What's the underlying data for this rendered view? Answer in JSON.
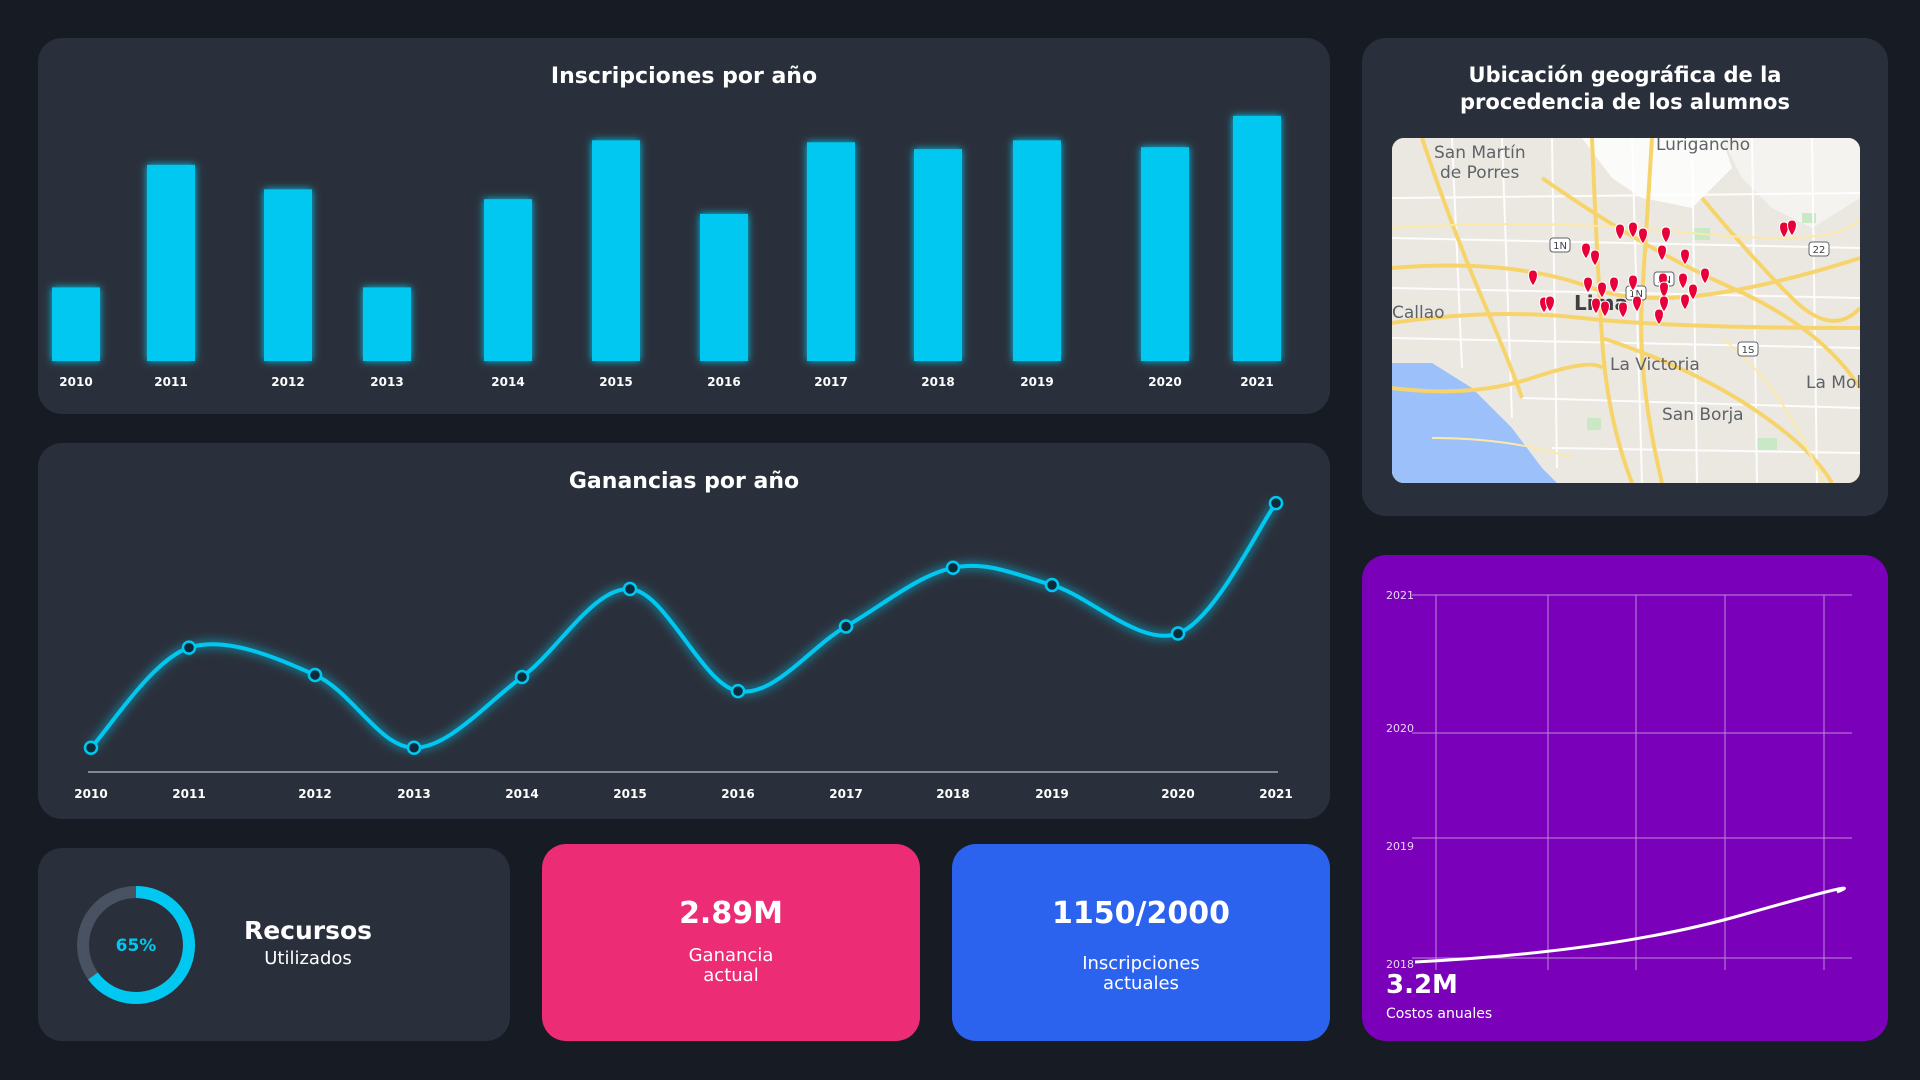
{
  "enrollments": {
    "title": "Inscripciones por año",
    "chart_data": {
      "type": "bar",
      "categories": [
        "2010",
        "2011",
        "2012",
        "2013",
        "2014",
        "2015",
        "2016",
        "2017",
        "2018",
        "2019",
        "2020",
        "2021"
      ],
      "values": [
        75,
        200,
        175,
        75,
        165,
        225,
        150,
        223,
        216,
        225,
        218,
        250
      ],
      "ylim": [
        0,
        260
      ],
      "color": "#00c8f0"
    }
  },
  "earnings": {
    "title": "Ganancias por año",
    "chart_data": {
      "type": "line",
      "categories": [
        "2010",
        "2011",
        "2012",
        "2013",
        "2014",
        "2015",
        "2016",
        "2017",
        "2018",
        "2019",
        "2020",
        "2021"
      ],
      "values": [
        23,
        122,
        95,
        23,
        93,
        180,
        79,
        143,
        201,
        184,
        136,
        265
      ],
      "ylim": [
        0,
        275
      ],
      "color": "#00c8f0"
    }
  },
  "map": {
    "title_line1": "Ubicación geográfica de la",
    "title_line2": "procedencia de los alumnos",
    "labels": {
      "san_martin_1": "San Martín",
      "san_martin_2": "de Porres",
      "lurigancho": "Lurigancho",
      "callao": "Callao",
      "lima": "Lima",
      "la_victoria": "La Victoria",
      "san_borja": "San Borja",
      "la_molina": "La Mol"
    },
    "highway_shields": [
      "1N",
      "1N",
      "1N",
      "22",
      "1S"
    ],
    "marker_color": "#e8003a"
  },
  "costs": {
    "value": "3.2M",
    "label": "Costos anuales",
    "chart_data": {
      "type": "line",
      "y_tick_labels": [
        "2018",
        "2019",
        "2020",
        "2021"
      ],
      "line_color": "#ffffff",
      "grid": true
    }
  },
  "resources": {
    "percent": 65,
    "percent_label": "65%",
    "title": "Recursos",
    "subtitle": "Utilizados",
    "ring_color": "#00c8f0",
    "track_color": "#495263"
  },
  "gain": {
    "value": "2.89M",
    "label": "Ganancia\nactual"
  },
  "inscriptions": {
    "value": "1150/2000",
    "label": "Inscripciones\nactuales"
  }
}
